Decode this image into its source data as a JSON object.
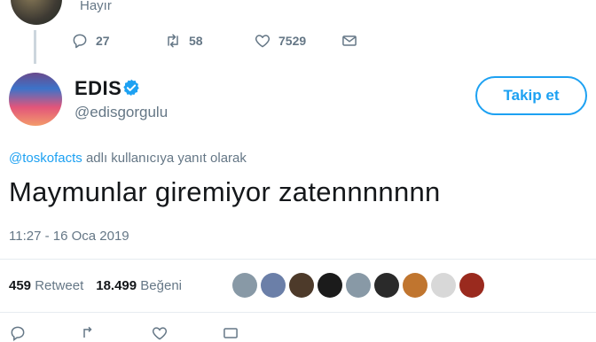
{
  "previous_tweet": {
    "reply_text": "Hayır",
    "actions": {
      "replies": "27",
      "retweets": "58",
      "likes": "7529"
    }
  },
  "tweet": {
    "author_name": "EDIS",
    "author_handle": "@edisgorgulu",
    "follow_label": "Takip et",
    "reply_mention": "@toskofacts",
    "reply_context": "adlı kullanıcıya yanıt olarak",
    "text": "Maymunlar giremiyor zatennnnnnn",
    "timestamp": "11:27 - 16 Oca 2019",
    "retweet_count": "459",
    "retweet_label": "Retweet",
    "like_count": "18.499",
    "like_label": "Beğeni"
  },
  "likers": [
    {
      "color": "#8899a6",
      "icon": "default-avatar"
    },
    {
      "color": "#6b7fa8",
      "icon": "avatar"
    },
    {
      "color": "#4d3a2a",
      "icon": "avatar"
    },
    {
      "color": "#1b1b1b",
      "icon": "avatar"
    },
    {
      "color": "#8899a6",
      "icon": "default-avatar"
    },
    {
      "color": "#2a2a2a",
      "icon": "avatar"
    },
    {
      "color": "#c0752f",
      "icon": "avatar"
    },
    {
      "color": "#d8d8d8",
      "icon": "avatar"
    },
    {
      "color": "#9a2a1e",
      "icon": "avatar"
    }
  ],
  "colors": {
    "accent": "#1da1f2",
    "muted": "#657786",
    "text": "#14171a"
  }
}
